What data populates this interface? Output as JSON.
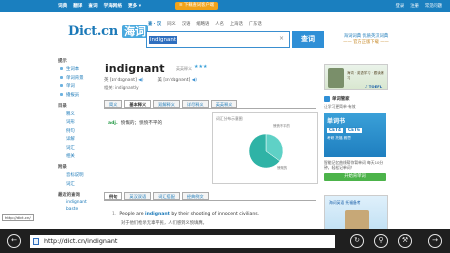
{
  "topbar": {
    "nav": [
      "词典",
      "翻译",
      "查词",
      "学海网络",
      "更多 ▾"
    ],
    "app_download": "≡ 下载查词客户端",
    "right": [
      "登录",
      "注册",
      "常见问题"
    ]
  },
  "header": {
    "logo_main": "Dict.cn",
    "logo_cn": "海词",
    "search_tabs": [
      "查 · 汉",
      "同义",
      "汉语",
      "缩略语",
      "人名",
      "上海话",
      "广东话"
    ],
    "search_value": "indignant",
    "search_button": "查词",
    "promo_line1": "海词词典 优质英汉词典",
    "promo_line2": "—— 官方正版下载 ——"
  },
  "sidebar": {
    "groups": [
      {
        "title": "提示",
        "items": [
          "生词本",
          "单词背景",
          "单词",
          "播报员"
        ]
      },
      {
        "title": "目录",
        "items": [
          "释义",
          "词形",
          "例句",
          "详解",
          "词汇",
          "相关"
        ]
      },
      {
        "title": "附录",
        "plain": [
          "音标说明",
          "词汇"
        ]
      },
      {
        "title": "最近的查询",
        "plain": [
          "indignant",
          "baste"
        ]
      }
    ]
  },
  "main": {
    "word": "indignant",
    "badge": "英英释义",
    "stars": "★★★",
    "phon_uk": "英 [ɪnˈdɪgnənt]",
    "phon_us": "美 [ɪnˈdɪgnənt]",
    "related": "相关: indignantly",
    "tabs": [
      "简义",
      "基本释义",
      "双解释义",
      "详尽释义",
      "英英释义"
    ],
    "definition_pos": "adj.",
    "definition_text": "愤慨的；愤愤不平的",
    "chart_title": "词汇分布示意图",
    "chart_label_a": "愤愤不平的",
    "chart_label_b": "愤慨的",
    "tabs2": [
      "例句",
      "英汉双语",
      "词汇搭配",
      "经典例文"
    ],
    "example_num": "1.",
    "example_pre": "People are",
    "example_word": "indignant",
    "example_post": "by their shooting of innocent civilians.",
    "example_cn": "对于他们枪杀无辜平民，人们感到义愤填膺。"
  },
  "right": {
    "ad1_text": "海词 · 英语学习 · 跟读练习",
    "ad1_logo": "♪ TOEFL",
    "panel_title": "单词管家",
    "panel_sub": "让学习更简单·有效",
    "book_title": "单词书",
    "book_cet": [
      "CET4",
      "CET6"
    ],
    "book_sub": "考研 托福 雅思",
    "panel_text": "智能记忆曲线帮你背单词\n每天10分钟，轻松记单词！",
    "panel_button": "开始背单词",
    "ad2_text": "海词英语 托福备考",
    "ad2_logo": "♪ TOEFL"
  },
  "tooltip": "http://dict.cn/",
  "ie": {
    "url": "http://dict.cn/indignant"
  },
  "chart_data": {
    "type": "pie",
    "categories": [
      "愤愤不平的",
      "愤慨的"
    ],
    "values": [
      35,
      65
    ]
  }
}
